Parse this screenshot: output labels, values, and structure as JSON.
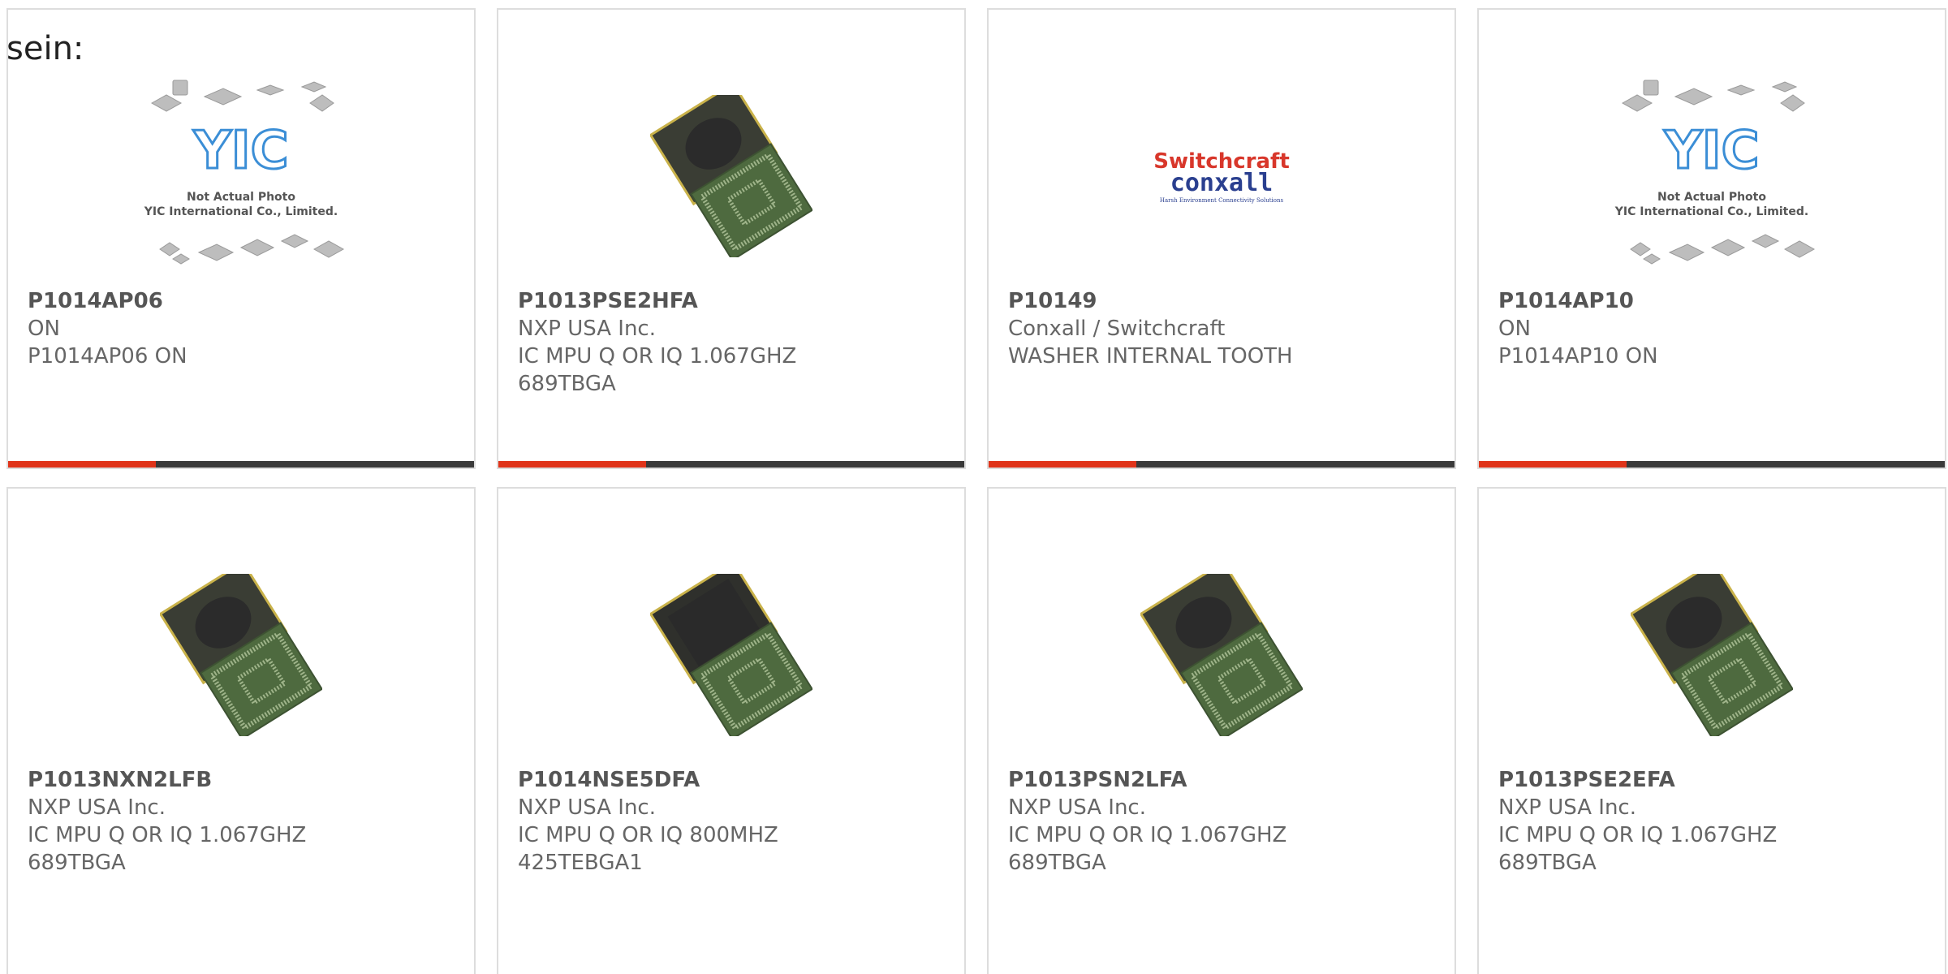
{
  "intro_text": "sein:",
  "colors": {
    "accent": "#e0341a",
    "bar": "#3a3a3a",
    "border": "#dddddd",
    "text": "#666666"
  },
  "products": [
    {
      "part_number": "P1014AP06",
      "manufacturer": "ON",
      "description_lines": [
        "P1014AP06 ON"
      ],
      "image": "yic-placeholder",
      "image_caption_lines": [
        "Not Actual Photo",
        "YIC International Co., Limited."
      ],
      "image_logo_text": "YIC"
    },
    {
      "part_number": "P1013PSE2HFA",
      "manufacturer": "NXP USA Inc.",
      "description_lines": [
        "IC MPU Q OR IQ 1.067GHZ",
        "689TBGA"
      ],
      "image": "bga-chip"
    },
    {
      "part_number": "P10149",
      "manufacturer": "Conxall / Switchcraft",
      "description_lines": [
        "WASHER INTERNAL TOOTH"
      ],
      "image": "switchcraft-conxall-logo",
      "logo_line1": "Switchcraft",
      "logo_line2": "conxall",
      "logo_tagline": "Harsh Environment Connectivity Solutions"
    },
    {
      "part_number": "P1014AP10",
      "manufacturer": "ON",
      "description_lines": [
        "P1014AP10 ON"
      ],
      "image": "yic-placeholder",
      "image_caption_lines": [
        "Not Actual Photo",
        "YIC International Co., Limited."
      ],
      "image_logo_text": "YIC"
    },
    {
      "part_number": "P1013NXN2LFB",
      "manufacturer": "NXP USA Inc.",
      "description_lines": [
        "IC MPU Q OR IQ 1.067GHZ",
        "689TBGA"
      ],
      "image": "bga-chip"
    },
    {
      "part_number": "P1014NSE5DFA",
      "manufacturer": "NXP USA Inc.",
      "description_lines": [
        "IC MPU Q OR IQ 800MHZ",
        "425TEBGA1"
      ],
      "image": "bga-chip"
    },
    {
      "part_number": "P1013PSN2LFA",
      "manufacturer": "NXP USA Inc.",
      "description_lines": [
        "IC MPU Q OR IQ 1.067GHZ",
        "689TBGA"
      ],
      "image": "bga-chip"
    },
    {
      "part_number": "P1013PSE2EFA",
      "manufacturer": "NXP USA Inc.",
      "description_lines": [
        "IC MPU Q OR IQ 1.067GHZ",
        "689TBGA"
      ],
      "image": "bga-chip"
    }
  ]
}
